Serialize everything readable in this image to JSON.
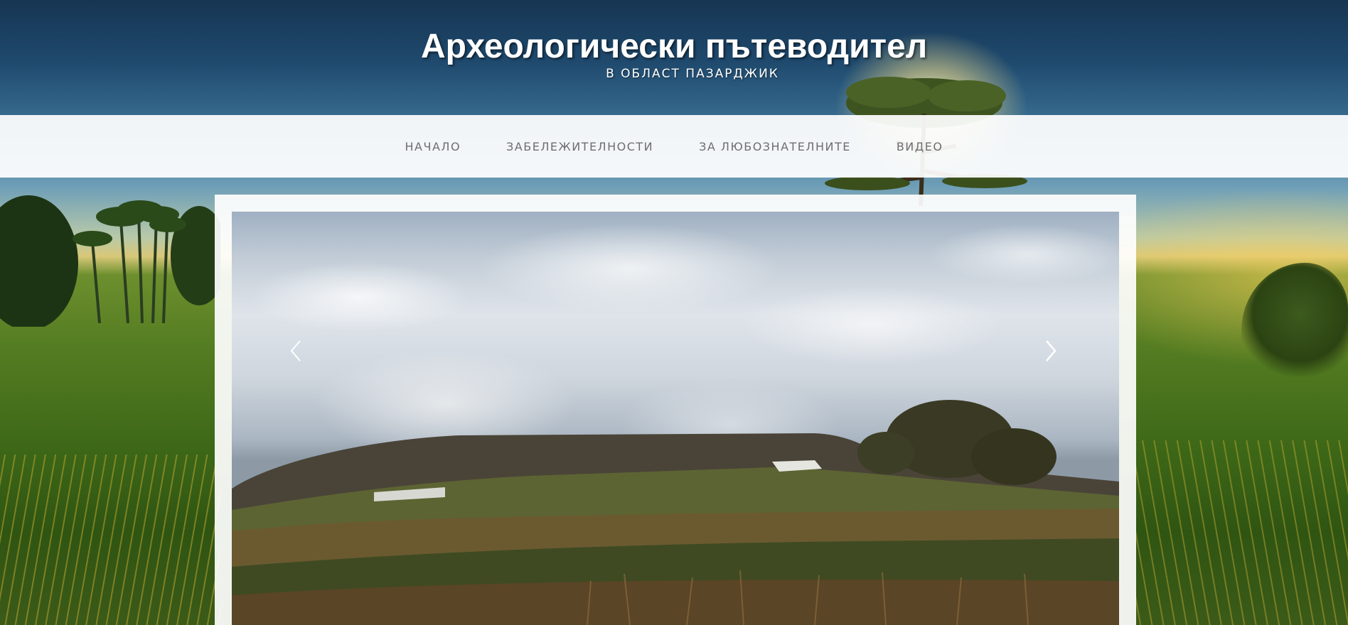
{
  "header": {
    "title": "Археологически пътеводител",
    "tagline": "В ОБЛАСТ ПАЗАРДЖИК"
  },
  "nav": {
    "items": [
      {
        "label": "НАЧАЛО"
      },
      {
        "label": "ЗАБЕЛЕЖИТЕЛНОСТИ"
      },
      {
        "label": "ЗА ЛЮБОЗНАТЕЛНИТЕ"
      },
      {
        "label": "ВИДЕО"
      }
    ]
  },
  "slider": {
    "prev_icon": "chevron-left-icon",
    "next_icon": "chevron-right-icon"
  },
  "colors": {
    "nav_background": "#f0f1f2",
    "nav_text": "#6e6e6e",
    "title_text": "#ffffff"
  }
}
